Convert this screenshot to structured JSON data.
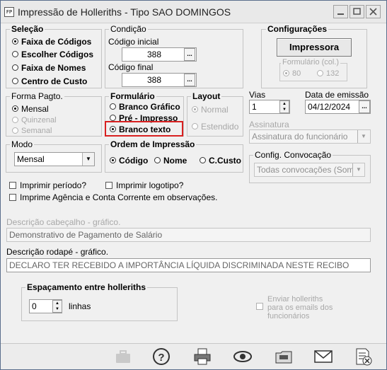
{
  "window": {
    "icon_text": "FP",
    "title": "Impressão de Holleriths - Tipo SAO DOMINGOS"
  },
  "selecao": {
    "legend": "Seleção",
    "options": [
      {
        "label": "Faixa de Códigos",
        "selected": true
      },
      {
        "label": "Escolher Códigos",
        "selected": false
      },
      {
        "label": "Faixa de Nomes",
        "selected": false
      },
      {
        "label": "Centro de Custo",
        "selected": false
      }
    ]
  },
  "condicao": {
    "legend": "Condição",
    "codigo_inicial_label": "Código inicial",
    "codigo_inicial_value": "388",
    "codigo_final_label": "Código final",
    "codigo_final_value": "388",
    "lookup_label": "..."
  },
  "configuracoes": {
    "legend": "Configurações",
    "impressora_button": "Impressora",
    "formulario_col_legend": "Formulário (col.)",
    "col_options": [
      {
        "label": "80",
        "selected": true
      },
      {
        "label": "132",
        "selected": false
      }
    ]
  },
  "forma_pagto": {
    "legend": "Forma Pagto.",
    "options": [
      {
        "label": "Mensal",
        "selected": true,
        "enabled": true
      },
      {
        "label": "Quinzenal",
        "selected": false,
        "enabled": false
      },
      {
        "label": "Semanal",
        "selected": false,
        "enabled": false
      }
    ]
  },
  "formulario": {
    "legend": "Formulário",
    "options": [
      {
        "label": "Branco Gráfico",
        "selected": false
      },
      {
        "label": "Pré - Impresso",
        "selected": false
      },
      {
        "label": "Branco texto",
        "selected": true
      }
    ]
  },
  "layout": {
    "legend": "Layout",
    "options": [
      {
        "label": "Normal",
        "selected": true
      },
      {
        "label": "Estendido",
        "selected": false
      }
    ]
  },
  "vias": {
    "label": "Vias",
    "value": "1"
  },
  "data_emissao": {
    "label": "Data de emissão",
    "value": "04/12/2024"
  },
  "assinatura": {
    "label": "Assinatura",
    "value": "Assinatura do funcionário"
  },
  "modo": {
    "legend": "Modo",
    "value": "Mensal"
  },
  "ordem": {
    "legend": "Ordem de Impressão",
    "options": [
      {
        "label": "Código",
        "selected": true
      },
      {
        "label": "Nome",
        "selected": false
      },
      {
        "label": "C.Custo",
        "selected": false
      }
    ]
  },
  "config_convocacao": {
    "legend": "Config. Convocação",
    "value": "Todas convocações (Somato"
  },
  "checks": {
    "imprimir_periodo": "Imprimir período?",
    "imprimir_logotipo": "Imprimir logotipo?",
    "imprime_agencia": "Imprime Agência e Conta Corrente em observações."
  },
  "descricoes": {
    "cabecalho_label": "Descrição cabeçalho - gráfico.",
    "cabecalho_value": "Demonstrativo de Pagamento de Salário",
    "rodape_label": "Descrição rodapé - gráfico.",
    "rodape_value": "DECLARO TER RECEBIDO A IMPORTÂNCIA LÍQUIDA DISCRIMINADA NESTE RECIBO"
  },
  "espacamento": {
    "legend": "Espaçamento entre holleriths",
    "value": "0",
    "unit": "linhas"
  },
  "enviar_emails": {
    "line1": "Enviar holleriths",
    "line2": "para os emails dos",
    "line3": "funcionários"
  },
  "toolbar": {
    "icons": [
      "briefcase-icon",
      "help-icon",
      "printer-icon",
      "preview-eye-icon",
      "folder-icon",
      "email-icon",
      "exit-icon"
    ]
  }
}
